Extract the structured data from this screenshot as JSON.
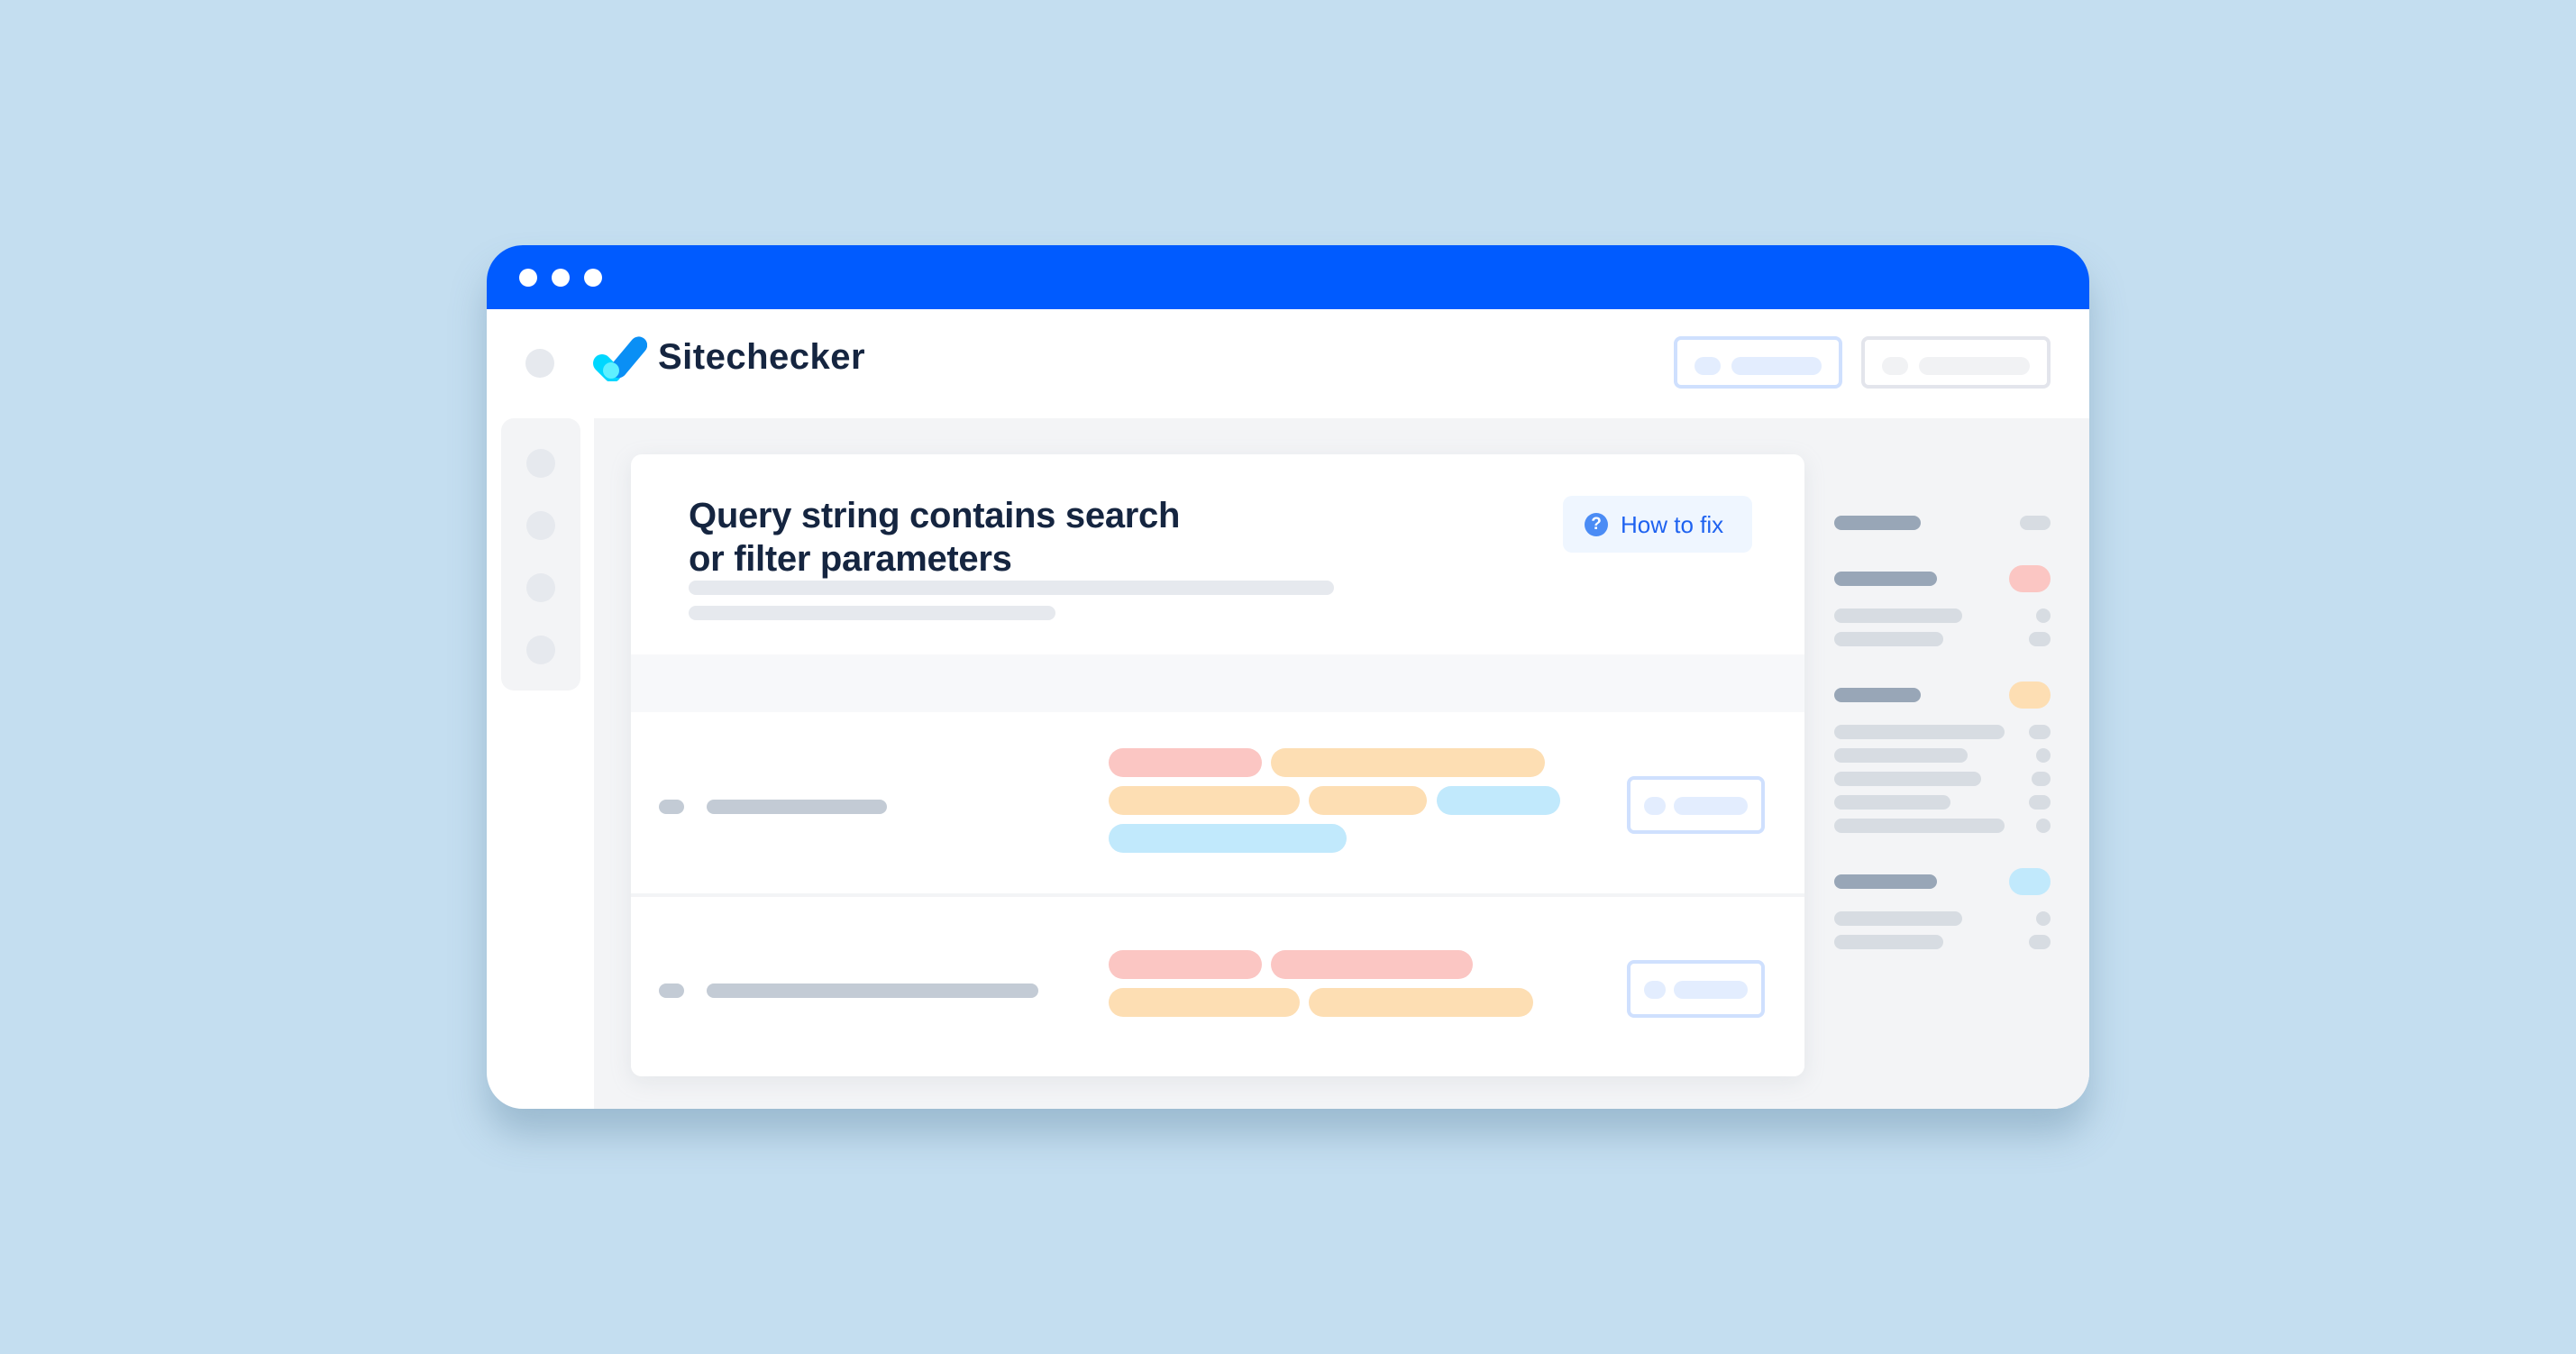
{
  "window": {
    "titlebar_dots": [
      "window-dot-1",
      "window-dot-2",
      "window-dot-3"
    ],
    "colors": {
      "titlebar": "#005bff",
      "background": "#c4def0",
      "brand_text": "#152540",
      "link": "#1e62f0"
    }
  },
  "header": {
    "brand_name": "Sitechecker",
    "logo_icon": "checkmark-logo-icon",
    "buttons": [
      {
        "name": "header-primary-button",
        "style": "primary-outline"
      },
      {
        "name": "header-secondary-button",
        "style": "neutral-outline"
      }
    ]
  },
  "left_nav": {
    "items": [
      "nav-item-1",
      "nav-item-2",
      "nav-item-3",
      "nav-item-4"
    ]
  },
  "issue_card": {
    "title_line1": "Query string contains search",
    "title_line2": "or filter parameters",
    "how_to_fix_label": "How to fix",
    "how_to_fix_icon": "question-circle-icon",
    "rows": [
      {
        "tags": [
          {
            "color": "red"
          },
          {
            "color": "orange"
          },
          {
            "color": "orange"
          },
          {
            "color": "orange"
          },
          {
            "color": "blue"
          },
          {
            "color": "blue"
          }
        ]
      },
      {
        "tags": [
          {
            "color": "red"
          },
          {
            "color": "red"
          },
          {
            "color": "orange"
          },
          {
            "color": "orange"
          }
        ]
      }
    ]
  },
  "right_panel": {
    "groups": [
      {
        "badge": "gray",
        "lines": 0
      },
      {
        "badge": "red",
        "lines": 2
      },
      {
        "badge": "orange",
        "lines": 5
      },
      {
        "badge": "blue",
        "lines": 2
      }
    ],
    "badge_colors": {
      "red": "#fbc6c3",
      "orange": "#fddeb3",
      "blue": "#c1e9fc",
      "gray": "#d7dce2"
    }
  }
}
